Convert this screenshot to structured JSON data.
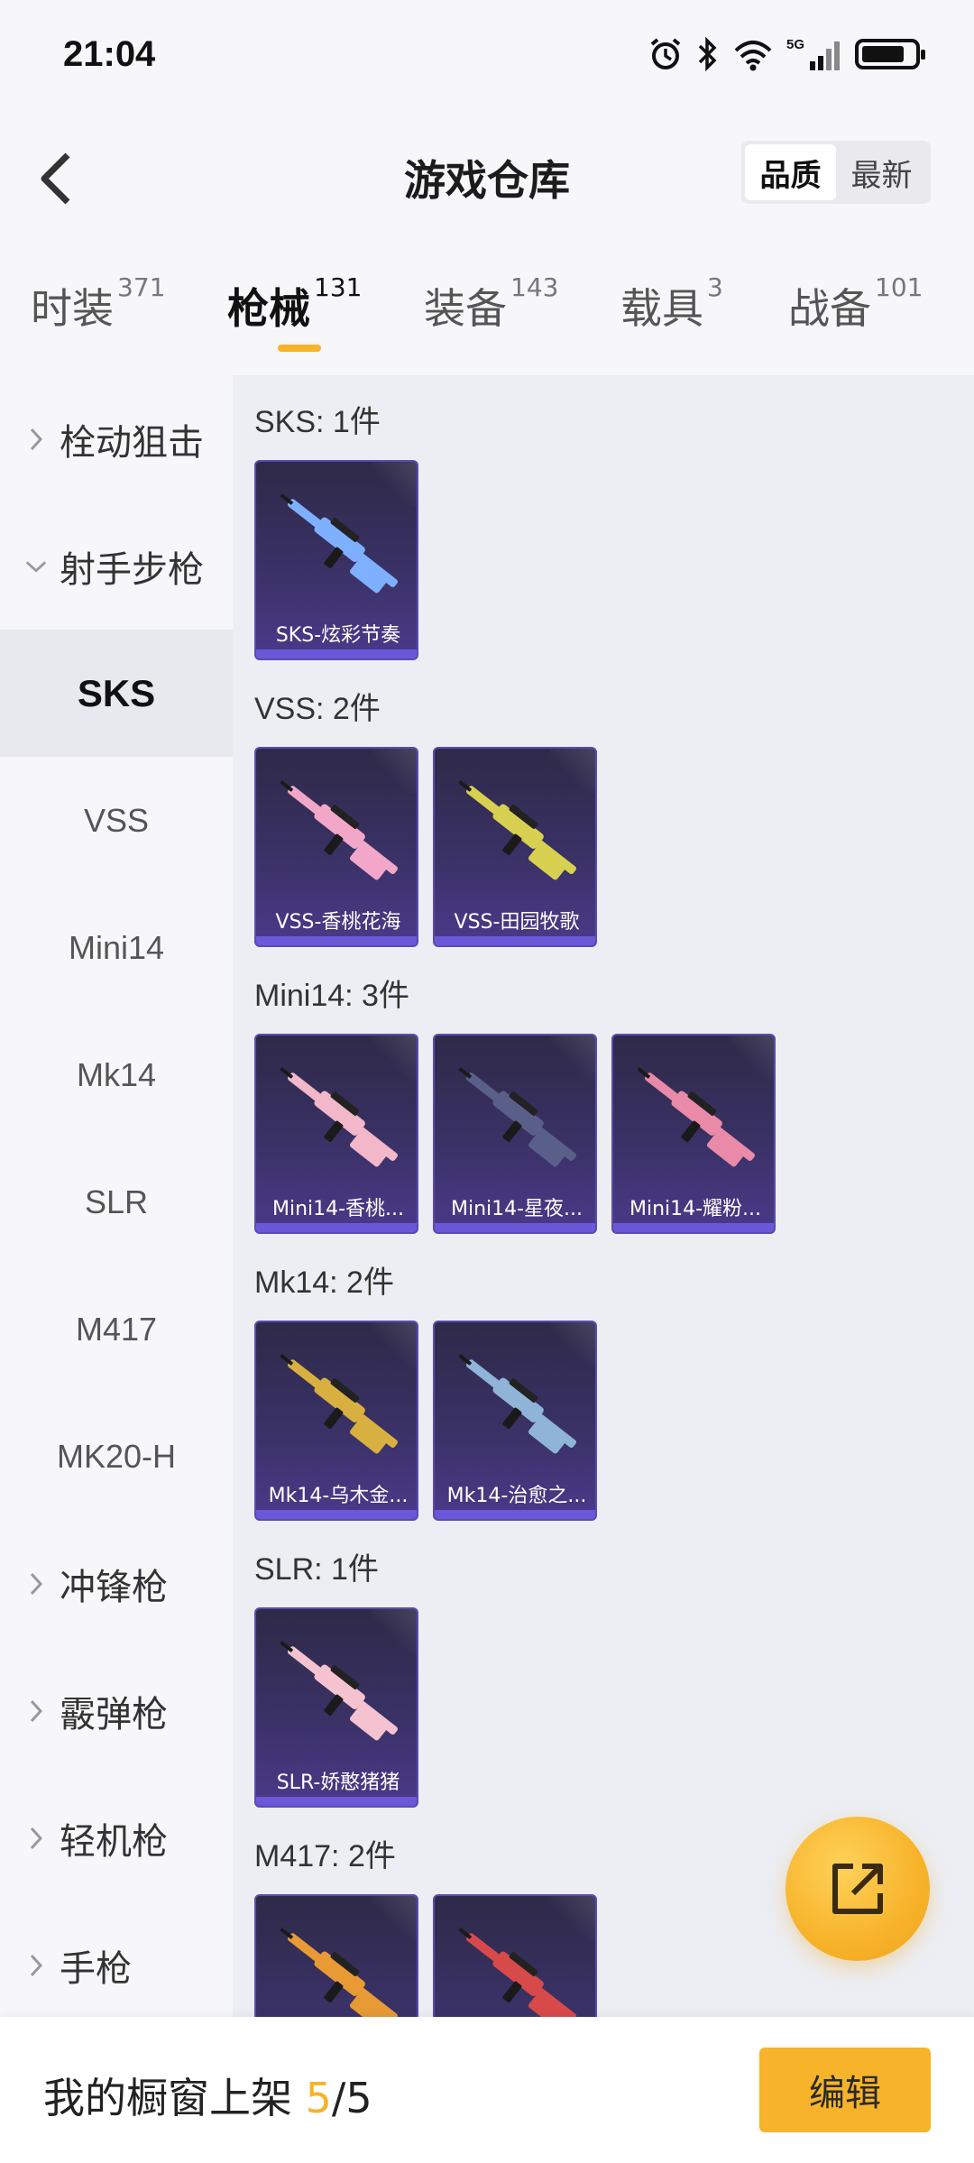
{
  "status_bar": {
    "time": "21:04"
  },
  "header": {
    "title": "游戏仓库",
    "sort_options": [
      "品质",
      "最新"
    ],
    "sort_selected": "品质"
  },
  "tabs": [
    {
      "label": "时装",
      "count": "371"
    },
    {
      "label": "枪械",
      "count": "131",
      "active": true
    },
    {
      "label": "装备",
      "count": "143"
    },
    {
      "label": "载具",
      "count": "3"
    },
    {
      "label": "战备",
      "count": "101"
    }
  ],
  "sidebar": {
    "groups": [
      {
        "label": "栓动狙击",
        "expanded": false
      },
      {
        "label": "射手步枪",
        "expanded": true
      },
      {
        "label": "冲锋枪",
        "expanded": false
      },
      {
        "label": "霰弹枪",
        "expanded": false
      },
      {
        "label": "轻机枪",
        "expanded": false
      },
      {
        "label": "手枪",
        "expanded": false
      }
    ],
    "sub_items": [
      "SKS",
      "VSS",
      "Mini14",
      "Mk14",
      "SLR",
      "M417",
      "MK20-H"
    ],
    "sub_selected": "SKS"
  },
  "sections": [
    {
      "title": "SKS: 1件",
      "items": [
        {
          "name": "SKS-炫彩节奏",
          "color": "#7fb0ff"
        }
      ]
    },
    {
      "title": "VSS: 2件",
      "items": [
        {
          "name": "VSS-香桃花海",
          "color": "#f3a7c8"
        },
        {
          "name": "VSS-田园牧歌",
          "color": "#d8d050"
        }
      ]
    },
    {
      "title": "Mini14: 3件",
      "items": [
        {
          "name": "Mini14-香桃...",
          "color": "#f2b7c9"
        },
        {
          "name": "Mini14-星夜...",
          "color": "#5a5f8a"
        },
        {
          "name": "Mini14-耀粉...",
          "color": "#e88aa8"
        }
      ]
    },
    {
      "title": "Mk14: 2件",
      "items": [
        {
          "name": "Mk14-乌木金...",
          "color": "#d7b040"
        },
        {
          "name": "Mk14-治愈之...",
          "color": "#8fb4d8"
        }
      ]
    },
    {
      "title": "SLR: 1件",
      "items": [
        {
          "name": "SLR-娇憨猪猪",
          "color": "#f4c3cf"
        }
      ]
    },
    {
      "title": "M417: 2件",
      "items": [
        {
          "name": "",
          "color": "#e89a35"
        },
        {
          "name": "",
          "color": "#d84a4a"
        }
      ]
    }
  ],
  "bottom_bar": {
    "prefix": "我的橱窗上架 ",
    "current": "5",
    "total": "/5",
    "edit_label": "编辑"
  },
  "colors": {
    "accent": "#f7b32a",
    "card_purple": "#4a3a8a"
  }
}
